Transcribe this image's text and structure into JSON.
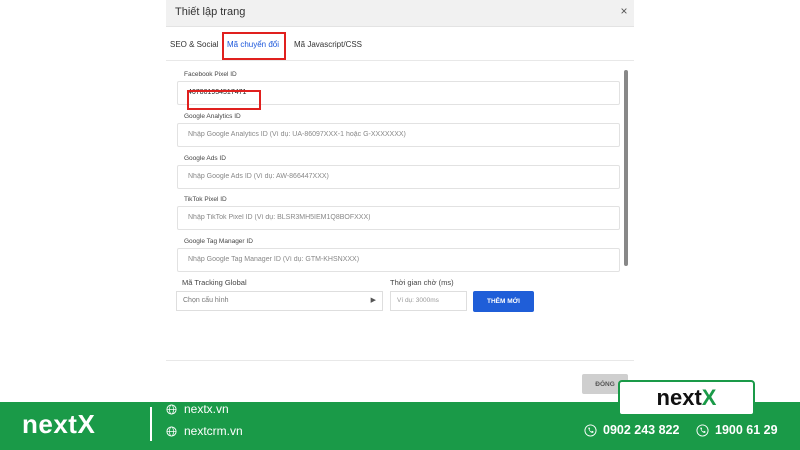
{
  "modal": {
    "title": "Thiết lập trang",
    "close_symbol": "×",
    "tabs": [
      {
        "label": "SEO & Social"
      },
      {
        "label": "Mã chuyển đổi"
      },
      {
        "label": "Mã Javascript/CSS"
      }
    ],
    "fields": [
      {
        "label": "Facebook Pixel ID",
        "value": "467801934517471",
        "placeholder": ""
      },
      {
        "label": "Google Analytics ID",
        "value": "",
        "placeholder": "Nhập Google Analytics ID (Ví dụ: UA-86097XXX-1 hoặc G-XXXXXXX)"
      },
      {
        "label": "Google Ads ID",
        "value": "",
        "placeholder": "Nhập Google Ads ID (Ví dụ: AW-866447XXX)"
      },
      {
        "label": "TikTok Pixel ID",
        "value": "",
        "placeholder": "Nhập TikTok Pixel ID (Ví dụ: BLSR3MH5IEM1Q8BOFXXX)"
      },
      {
        "label": "Google Tag Manager ID",
        "value": "",
        "placeholder": "Nhập Google Tag Manager ID (Ví dụ: GTM-KHSNXXX)"
      }
    ],
    "tracking": {
      "label": "Mã Tracking Global",
      "select_text": "Chọn cấu hình",
      "time_label": "Thời gian chờ (ms)",
      "time_placeholder": "Ví dụ: 3000ms",
      "add_button": "THÊM MỚI"
    },
    "close_button": "ĐÓNG"
  },
  "banner": {
    "logo": "nextX",
    "links": [
      "nextx.vn",
      "nextcrm.vn"
    ],
    "phones": [
      "0902 243 822",
      "1900 61 29"
    ],
    "card_logo_main": "next",
    "card_logo_accent": "X"
  },
  "colors": {
    "brand_green": "#1a9a48",
    "primary_blue": "#1f5ed8",
    "highlight_red": "#e0201e"
  },
  "icons": [
    "close-icon",
    "chevron-right-icon",
    "globe-icon",
    "phone-icon",
    "hotline-icon"
  ]
}
